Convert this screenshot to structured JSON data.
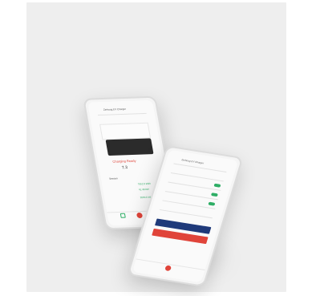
{
  "scene": {
    "description_free": true,
    "phone_back": {
      "header_title": "Zerhoug EV Charger",
      "status_label": "Charging",
      "status_value": "Ready",
      "charge_value": "7.3",
      "session_label": "Session",
      "energy_value": "7952.0 kWh",
      "power_value": "41.49 kW",
      "cost_value": "2000.0 kWh",
      "colors": {
        "accent_red": "#e0443a",
        "accent_green": "#2fae66"
      }
    },
    "phone_front": {
      "header_title": "Zerhoug EV Charger",
      "primary_button_color": "#1f3a7a",
      "secondary_button_color": "#e0443a"
    }
  }
}
